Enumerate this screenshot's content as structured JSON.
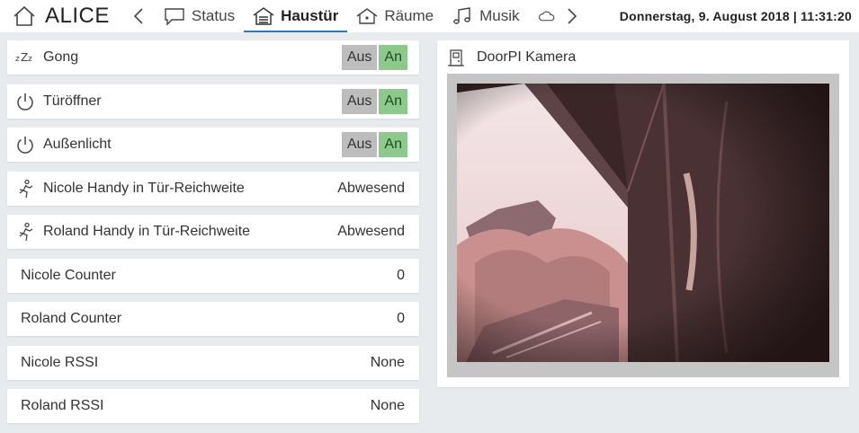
{
  "app": {
    "title": "ALICE"
  },
  "datetime": "Donnerstag, 9. August 2018 | 11:31:20",
  "tabs": [
    {
      "label": "Status",
      "icon": "chat-bubble-icon"
    },
    {
      "label": "Haustür",
      "icon": "garage-house-icon",
      "active": true
    },
    {
      "label": "Räume",
      "icon": "house-icon"
    },
    {
      "label": "Musik",
      "icon": "music-notes-icon"
    },
    {
      "label": "",
      "icon": "cloud-icon"
    }
  ],
  "rows": [
    {
      "label": "Gong",
      "icon": "sleep-zzz-icon",
      "off": "Aus",
      "on": "An"
    },
    {
      "label": "Türöffner",
      "icon": "power-icon",
      "off": "Aus",
      "on": "An"
    },
    {
      "label": "Außenlicht",
      "icon": "power-icon",
      "off": "Aus",
      "on": "An"
    },
    {
      "label": "Nicole Handy in Tür-Reichweite",
      "icon": "running-person-icon",
      "value": "Abwesend"
    },
    {
      "label": "Roland Handy in Tür-Reichweite",
      "icon": "running-person-icon",
      "value": "Abwesend"
    },
    {
      "label": "Nicole Counter",
      "value": "0"
    },
    {
      "label": "Roland Counter",
      "value": "0"
    },
    {
      "label": "Nicole RSSI",
      "value": "None"
    },
    {
      "label": "Roland RSSI",
      "value": "None"
    }
  ],
  "camera": {
    "title": "DoorPI Kamera",
    "icon": "camera-door-icon"
  },
  "colors": {
    "accent": "#2a7ab8",
    "switch_on": "#8dc88d",
    "switch_off": "#bdbdbd",
    "background": "#e8ebee"
  }
}
